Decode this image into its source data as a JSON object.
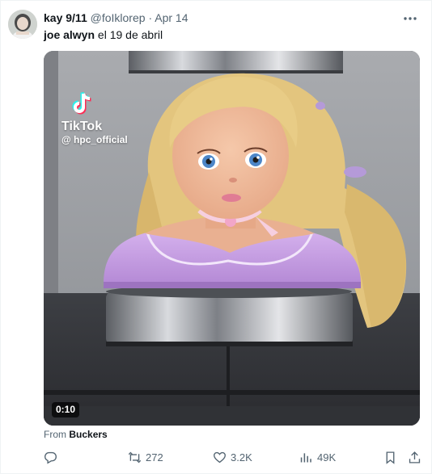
{
  "tweet": {
    "author_name": "kay 9/11",
    "author_handle": "@foIklorep",
    "separator": "·",
    "date": "Apr 14",
    "text_bold": "joe alwyn",
    "text_rest": " el 19 de abril"
  },
  "media": {
    "watermark_brand": "TikTok",
    "watermark_user": "@ hpc_official",
    "duration": "0:10"
  },
  "source": {
    "prefix": "From ",
    "name": "Buckers"
  },
  "actions": {
    "reply_count": "",
    "retweet_count": "272",
    "like_count": "3.2K",
    "view_count": "49K"
  },
  "icons": [
    "more-icon",
    "reply-icon",
    "retweet-icon",
    "like-icon",
    "views-icon",
    "bookmark-icon",
    "share-icon",
    "tiktok-icon"
  ],
  "colors": {
    "text": "#0f1419",
    "secondary": "#536471",
    "doll_dress": "#c9a2e4"
  }
}
